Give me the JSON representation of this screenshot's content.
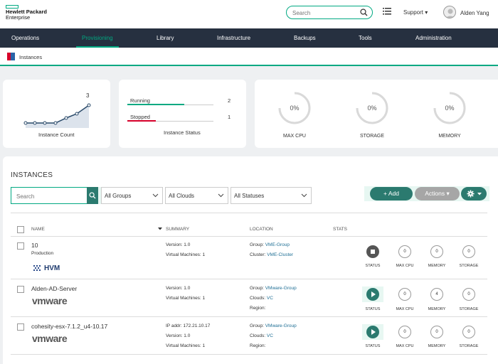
{
  "header": {
    "logo_line1": "Hewlett Packard",
    "logo_line2": "Enterprise",
    "search_placeholder": "Search",
    "support_label": "Support ▾",
    "username": "Alden Yang",
    "accent": "#01a982"
  },
  "nav": {
    "items": [
      {
        "label": "Operations"
      },
      {
        "label": "Provisioning"
      },
      {
        "label": "Library"
      },
      {
        "label": "Infrastructure"
      },
      {
        "label": "Backups"
      },
      {
        "label": "Tools"
      },
      {
        "label": "Administration"
      }
    ],
    "active": "Provisioning"
  },
  "breadcrumb": {
    "label": "Instances"
  },
  "summary": {
    "instance_count": {
      "label": "Instance Count",
      "value": "3"
    },
    "instance_status": {
      "label": "Instance Status",
      "rows": [
        {
          "label": "Running",
          "value": "2",
          "color": "#01a982"
        },
        {
          "label": "Stopped",
          "value": "1",
          "color": "#d6002a"
        }
      ]
    },
    "gauges": [
      {
        "label": "MAX CPU",
        "value": "0%"
      },
      {
        "label": "STORAGE",
        "value": "0%"
      },
      {
        "label": "MEMORY",
        "value": "0%"
      }
    ]
  },
  "instances": {
    "title": "INSTANCES",
    "search_placeholder": "Search",
    "filters": [
      {
        "label": "All Groups"
      },
      {
        "label": "All Clouds"
      },
      {
        "label": "All Statuses"
      }
    ],
    "add_label": "+ Add",
    "actions_label": "Actions ▾",
    "columns": {
      "name": "NAME",
      "summary": "SUMMARY",
      "location": "LOCATION",
      "stats": "STATS"
    },
    "stat_labels": {
      "status": "STATUS",
      "max_cpu": "MAX CPU",
      "memory": "MEMORY",
      "storage": "STORAGE"
    },
    "rows": [
      {
        "name": "10",
        "subtitle": "Production",
        "logo": "HVM",
        "summary1": "Version: 1.0",
        "summary2": "Virtual Machines: 1",
        "loc1_label": "Group: ",
        "loc1_value": "VME-Group",
        "loc2_label": "Cluster: ",
        "loc2_value": "VME-Cluster",
        "status": "stopped",
        "max_cpu": "0",
        "memory": "0",
        "storage": "0"
      },
      {
        "name": "Alden-AD-Server",
        "logo": "vmware",
        "summary1": "Version: 1.0",
        "summary2": "Virtual Machines: 1",
        "loc1_label": "Group: ",
        "loc1_value": "VMware-Group",
        "loc2_label": "Clouds: ",
        "loc2_value": "VC",
        "loc3_label": "Region:",
        "status": "running",
        "max_cpu": "0",
        "memory": "4",
        "storage": "0"
      },
      {
        "name": "cohesity-esx-7.1.2_u4-10.17",
        "logo": "vmware",
        "summary0": "IP addr: 172.21.10.17",
        "summary1": "Version: 1.0",
        "summary2": "Virtual Machines: 1",
        "loc1_label": "Group: ",
        "loc1_value": "VMware-Group",
        "loc2_label": "Clouds: ",
        "loc2_value": "VC",
        "loc3_label": "Region:",
        "status": "running",
        "max_cpu": "0",
        "memory": "0",
        "storage": "0"
      }
    ]
  }
}
